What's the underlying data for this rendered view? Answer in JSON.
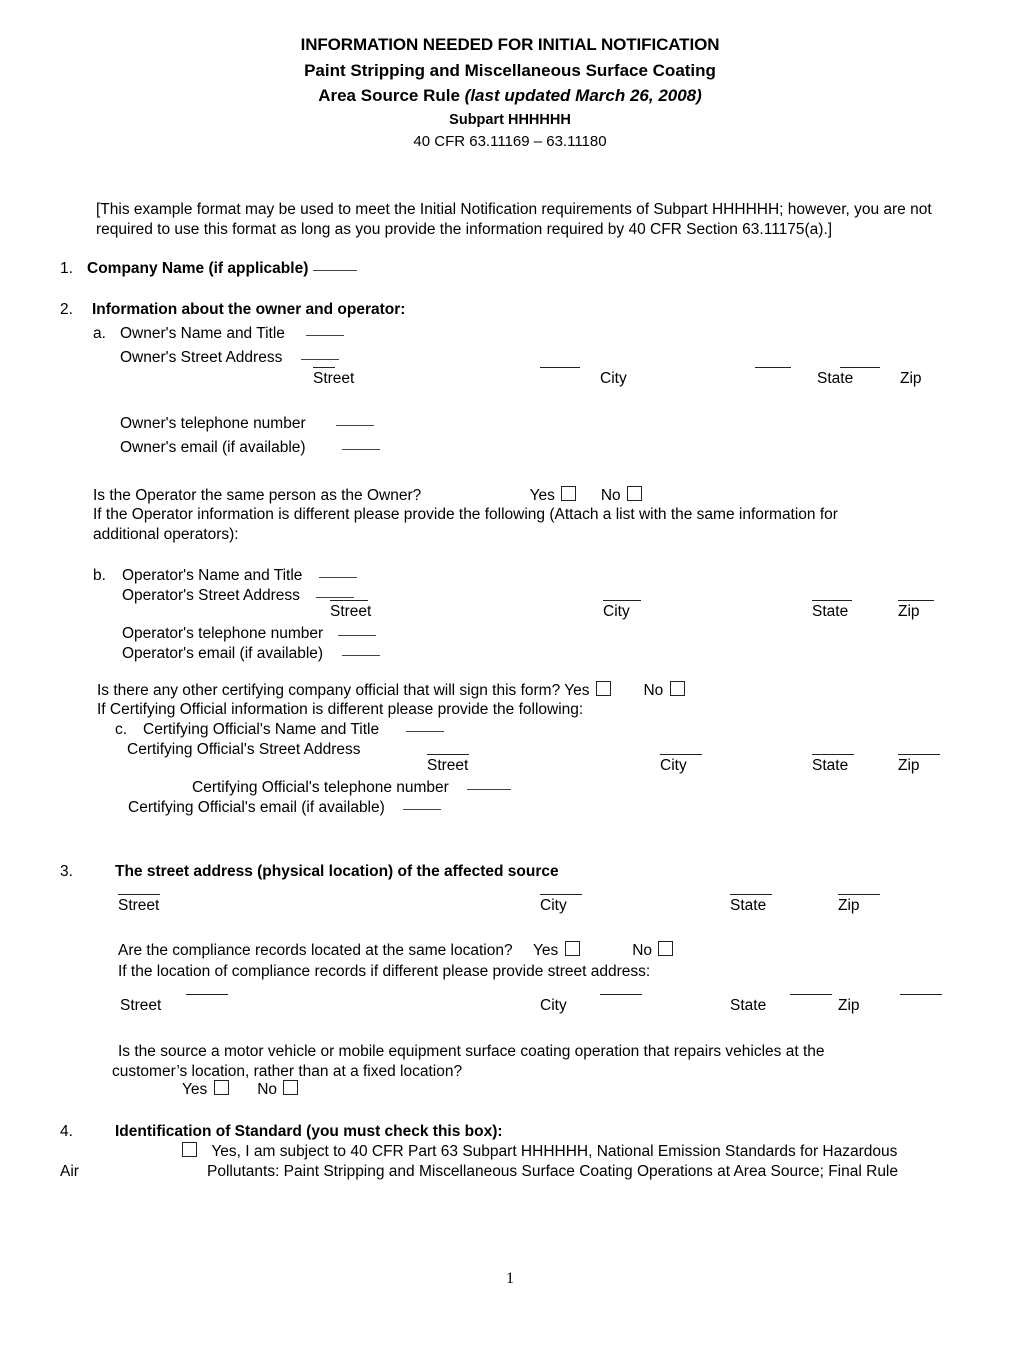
{
  "header": {
    "line1": "INFORMATION NEEDED FOR INITIAL NOTIFICATION",
    "line2": "Paint Stripping and Miscellaneous Surface Coating",
    "line3_a": "Area Source Rule ",
    "line3_b": "(last updated March 26, 2008)",
    "line4": "Subpart HHHHHH",
    "line5": "40 CFR 63.11169 – 63.11180"
  },
  "note": {
    "text": "[This example format may be used to meet the Initial Notification requirements of Subpart HHHHHH; however, you are not required to use this format as long as you provide the information required by 40 CFR Section 63.11175(a).]"
  },
  "item1": {
    "number": "1.",
    "label": "Company Name (if applicable)"
  },
  "item2": {
    "number": "2.",
    "label": "Information about the owner and operator:",
    "a": {
      "marker": "a.",
      "name_title": "Owner's Name and Title",
      "street_address": "Owner's Street Address",
      "telephone": "Owner's telephone number",
      "email": "Owner's email (if available)",
      "addr_labels": {
        "street": "Street",
        "city": "City",
        "state": "State",
        "zip": "Zip"
      }
    },
    "operator_same_question": "Is the Operator the same person as the Owner?",
    "yes": "Yes",
    "no": "No",
    "operator_different_note": "If the Operator information is different please provide the following (Attach a list with the same information for additional operators):",
    "b": {
      "marker": "b.",
      "name_title": "Operator's Name and Title",
      "street_address": "Operator's Street Address",
      "telephone": "Operator's telephone number",
      "email": "Operator's email (if available)",
      "addr_labels": {
        "street": "Street",
        "city": "City",
        "state": "State",
        "zip": "Zip"
      }
    },
    "certifying_question": "Is there any other certifying company official that will sign this form?",
    "certifying_note": "If Certifying Official information is different please provide the following:",
    "c": {
      "marker": "c.",
      "name_title": "Certifying Official's Name and Title",
      "street_address": "Certifying Official's Street Address",
      "telephone": "Certifying Official's telephone number",
      "email": "Certifying Official's email (if available)",
      "addr_labels": {
        "street": "Street",
        "city": "City",
        "state": "State",
        "zip": "Zip"
      }
    }
  },
  "item3": {
    "number": "3.",
    "label": "The street address (physical location) of the affected source",
    "addr_labels": {
      "street": "Street",
      "city": "City",
      "state": "State",
      "zip": "Zip"
    },
    "records_question": "Are the compliance records located at the same location?",
    "yes": "Yes",
    "no": "No",
    "records_note": "If the location of compliance records if different please provide street address:",
    "addr_labels2": {
      "street": "Street",
      "city": "City",
      "state": "State",
      "zip": "Zip"
    },
    "mobile_question_line1": "Is the source a motor vehicle or mobile equipment surface coating operation that repairs vehicles at the",
    "mobile_question_line2": "customer’s location, rather than at a fixed location?"
  },
  "item4": {
    "number": "4.",
    "label": "Identification of Standard (you must check this box):",
    "checkbox_text_line1": "Yes, I am subject to 40 CFR Part 63 Subpart HHHHHH, National Emission Standards for Hazardous",
    "left_word": "Air",
    "checkbox_text_line2": "Pollutants: Paint Stripping and Miscellaneous Surface Coating Operations at Area Source; Final Rule"
  },
  "footer": {
    "page_number": "1"
  }
}
